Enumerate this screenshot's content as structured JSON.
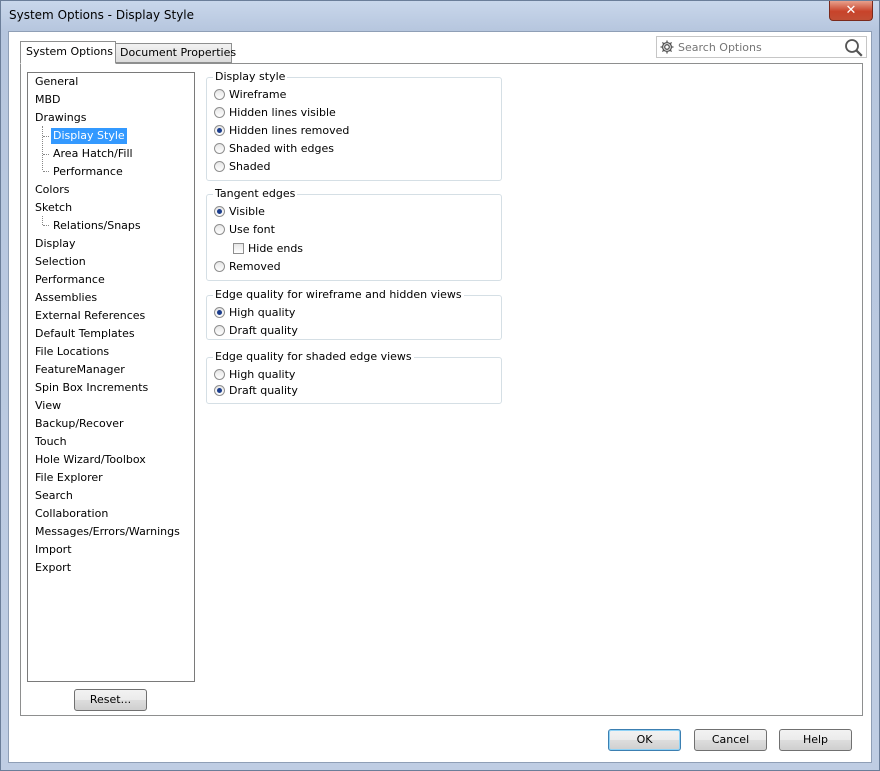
{
  "window": {
    "title": "System Options - Display Style",
    "close_symbol": "✕"
  },
  "tabs": [
    {
      "label": "System Options",
      "active": true
    },
    {
      "label": "Document Properties",
      "active": false
    }
  ],
  "search": {
    "placeholder": "Search Options",
    "left_icon": "gear-icon",
    "right_icon": "search-icon"
  },
  "tree": {
    "items": [
      {
        "label": "General",
        "level": 0
      },
      {
        "label": "MBD",
        "level": 0
      },
      {
        "label": "Drawings",
        "level": 0
      },
      {
        "label": "Display Style",
        "level": 1,
        "selected": true
      },
      {
        "label": "Area Hatch/Fill",
        "level": 1
      },
      {
        "label": "Performance",
        "level": 1
      },
      {
        "label": "Colors",
        "level": 0
      },
      {
        "label": "Sketch",
        "level": 0
      },
      {
        "label": "Relations/Snaps",
        "level": 1
      },
      {
        "label": "Display",
        "level": 0
      },
      {
        "label": "Selection",
        "level": 0
      },
      {
        "label": "Performance",
        "level": 0
      },
      {
        "label": "Assemblies",
        "level": 0
      },
      {
        "label": "External References",
        "level": 0
      },
      {
        "label": "Default Templates",
        "level": 0
      },
      {
        "label": "File Locations",
        "level": 0
      },
      {
        "label": "FeatureManager",
        "level": 0
      },
      {
        "label": "Spin Box Increments",
        "level": 0
      },
      {
        "label": "View",
        "level": 0
      },
      {
        "label": "Backup/Recover",
        "level": 0
      },
      {
        "label": "Touch",
        "level": 0
      },
      {
        "label": "Hole Wizard/Toolbox",
        "level": 0
      },
      {
        "label": "File Explorer",
        "level": 0
      },
      {
        "label": "Search",
        "level": 0
      },
      {
        "label": "Collaboration",
        "level": 0
      },
      {
        "label": "Messages/Errors/Warnings",
        "level": 0
      },
      {
        "label": "Import",
        "level": 0
      },
      {
        "label": "Export",
        "level": 0
      }
    ],
    "reset_label": "Reset..."
  },
  "groups": {
    "display_style": {
      "title": "Display style",
      "options": [
        {
          "label": "Wireframe",
          "selected": false
        },
        {
          "label": "Hidden lines visible",
          "selected": false
        },
        {
          "label": "Hidden lines removed",
          "selected": true
        },
        {
          "label": "Shaded with edges",
          "selected": false
        },
        {
          "label": "Shaded",
          "selected": false
        }
      ]
    },
    "tangent_edges": {
      "title": "Tangent edges",
      "visible": {
        "label": "Visible",
        "selected": true
      },
      "use_font": {
        "label": "Use font",
        "selected": false
      },
      "hide_ends": {
        "label": "Hide ends",
        "checked": false
      },
      "removed": {
        "label": "Removed",
        "selected": false
      }
    },
    "edge_quality_wireframe": {
      "title": "Edge quality for wireframe and hidden views",
      "options": [
        {
          "label": "High quality",
          "selected": true
        },
        {
          "label": "Draft quality",
          "selected": false
        }
      ]
    },
    "edge_quality_shaded": {
      "title": "Edge quality for shaded edge views",
      "options": [
        {
          "label": "High quality",
          "selected": false
        },
        {
          "label": "Draft quality",
          "selected": true
        }
      ]
    }
  },
  "buttons": {
    "ok": "OK",
    "cancel": "Cancel",
    "help": "Help"
  }
}
